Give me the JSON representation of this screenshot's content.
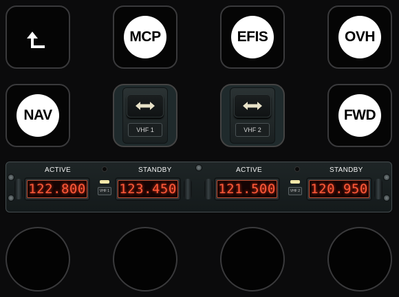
{
  "buttons_row1": {
    "back_icon": "corner-up-left-arrow-icon",
    "mcp_label": "MCP",
    "efis_label": "EFIS",
    "ovh_label": "OVH"
  },
  "buttons_row2": {
    "nav_label": "NAV",
    "vhf1_label": "VHF 1",
    "vhf2_label": "VHF 2",
    "vhf_icon": "double-arrow-horizontal-icon",
    "fwd_label": "FWD"
  },
  "radio": {
    "active_label": "ACTIVE",
    "standby_label": "STANDBY",
    "vhf1": {
      "active_freq": "122.800",
      "standby_freq": "123.450",
      "transfer_label": "VHF 1"
    },
    "vhf2": {
      "active_freq": "121.500",
      "standby_freq": "120.950",
      "transfer_label": "VHF 2"
    }
  },
  "colors": {
    "background": "#0b0b0c",
    "key_border": "#3a3a3c",
    "label_circle": "#ffffff",
    "freq_digits": "#ff5a3a",
    "transfer_light": "#f4e7a8"
  }
}
